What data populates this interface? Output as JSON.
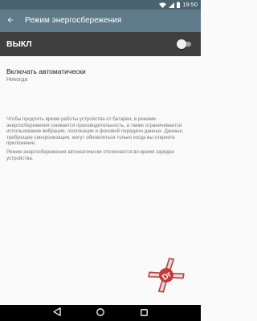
{
  "status_bar": {
    "time": "19:50"
  },
  "app_bar": {
    "title": "Режим энергосбережения"
  },
  "master_switch": {
    "label": "ВЫКЛ",
    "checked": false
  },
  "auto_setting": {
    "title": "Включать автоматически",
    "summary": "Никогда"
  },
  "footer": {
    "paragraph_1": "Чтобы продлить время работы устройства от батареи, в режиме энергосбережения снижается производительность, а также ограничивается использование вибрации, геолокации и фоновой передачи данных. Данные, требующие синхронизации, могут обновляться только когда вы откроете приложение.",
    "paragraph_2": "Режим энергосбережения автоматически отключается во время зарядки устройства."
  },
  "watermark": {
    "text": "Dr"
  },
  "icons": {
    "back": "arrow-back-icon",
    "wifi": "wifi-icon",
    "signal": "cell-signal-icon",
    "battery": "battery-icon",
    "nav_back": "nav-back-icon",
    "nav_home": "nav-home-icon",
    "nav_recent": "nav-recent-icon"
  },
  "colors": {
    "status_bar": "#4a636f",
    "app_bar": "#5f7b89",
    "master_bar": "#3f3f3f",
    "background": "#fafafa"
  }
}
